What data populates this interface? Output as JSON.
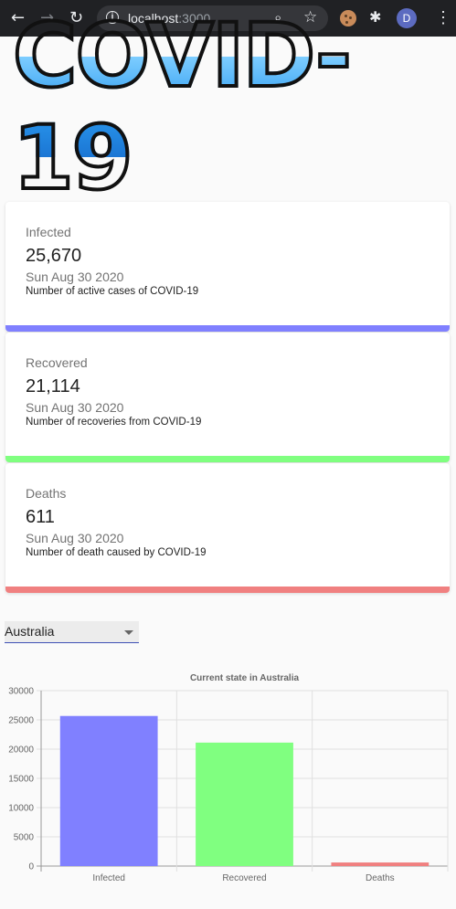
{
  "browser": {
    "host": "localhost",
    "port": ":3000",
    "profile_initial": "D"
  },
  "logo": {
    "text": "COVID-19"
  },
  "cards": [
    {
      "title": "Infected",
      "value": "25,670",
      "date": "Sun Aug 30 2020",
      "description": "Number of active cases of COVID-19",
      "color": "#8080ff"
    },
    {
      "title": "Recovered",
      "value": "21,114",
      "date": "Sun Aug 30 2020",
      "description": "Number of recoveries from COVID-19",
      "color": "#80ff80"
    },
    {
      "title": "Deaths",
      "value": "611",
      "date": "Sun Aug 30 2020",
      "description": "Number of death caused by COVID-19",
      "color": "#f08080"
    }
  ],
  "country_select": {
    "selected": "Australia"
  },
  "chart_data": {
    "type": "bar",
    "title": "Current state in Australia",
    "categories": [
      "Infected",
      "Recovered",
      "Deaths"
    ],
    "values": [
      25670,
      21114,
      611
    ],
    "colors": [
      "#8080ff",
      "#80ff80",
      "#f08080"
    ],
    "ylim": [
      0,
      30000
    ],
    "yticks": [
      0,
      5000,
      10000,
      15000,
      20000,
      25000,
      30000
    ],
    "grid": true,
    "xlabel": "",
    "ylabel": ""
  }
}
